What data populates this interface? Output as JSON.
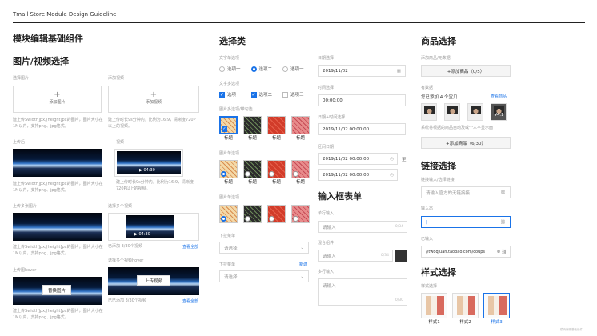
{
  "header": {
    "title": "Tmall Store Module Design Guideline"
  },
  "col1": {
    "main_title": "模块编辑基础组件",
    "section_title": "图片/视频选择",
    "select_image_label": "选择图片",
    "add_image_label": "添加图片",
    "add_video_section_label": "添加视频",
    "add_video_label": "添加视频",
    "image_hint": "建上传Swidth]px,(height]px的图片，图片大小在1M以内，支持png、jpg格式。",
    "video_hint": "建上传时长9s分钟内，比例为16:9，清晰度720P以上的视频。",
    "uploaded_label": "上传后",
    "video_label": "视频",
    "video_time": "04:30",
    "video_hint2": "建上传时长9s分钟内，比例为16:9，清晰度720P以上的视频。",
    "image_hint2": "建上传Swidth]px,(height]px的图片，图片大小在1M以内，支持png、jpg格式。",
    "multi_image_label": "上传多张图片",
    "multi_video_label": "选择多个视频",
    "multi_video_time": "04:30",
    "multi_video_count": "已添加 3/30个视频",
    "view_all": "查看全部",
    "image_hint3": "建上传Swidth]px,(height]px的图片，图片大小在1M以内，支持png、jpg格式。",
    "hover_label": "上传图hover",
    "replace_btn": "替换图片",
    "multi_video_hover_label": "选择多个视频hover",
    "upload_video_btn": "上传视频",
    "multi_video_count2": "已已添加 3/30个视频",
    "view_all2": "查看全部",
    "image_hint4": "建上传Swidth]px,(height]px的图片，图片大小在1M以内，支持png、jpg格式。"
  },
  "col2": {
    "title": "选择类",
    "text_single_label": "文字单选项",
    "radio_options": [
      "选项一",
      "选项二",
      "选项一"
    ],
    "text_multi_label": "文字多选项",
    "check_options": [
      "选项一",
      "选项二",
      "选项三"
    ],
    "img_multi_label": "图片多选项/带勾选",
    "img_single_label": "图片单选项",
    "img_single_label2": "图片单选项",
    "tile_caption": "标题",
    "dropdown_label": "下拉菜单",
    "dropdown_placeholder": "请选择",
    "dropdown2_label": "下拉菜单",
    "dropdown2_new": "新建",
    "dropdown2_placeholder": "请选择"
  },
  "col3": {
    "date_label": "日期选择",
    "date_value": "2019/11/02",
    "time_label": "时间选择",
    "time_value": "00:00:00",
    "datetime_label": "日期+时间选择",
    "datetime_value": "2019/11/02 00:00:00",
    "range_label": "区间日期",
    "range_start": "2019/11/02 00:00:00",
    "range_sep": "至",
    "range_end": "2019/11/02 00:00:00",
    "form_title": "输入框表单",
    "single_input_label": "单行输入",
    "single_input_placeholder": "请输入",
    "single_input_count": "0/34",
    "mixed_label": "混合组件",
    "mixed_placeholder": "请输入",
    "mixed_count": "0/34",
    "multi_input_label": "多行输入",
    "multi_input_placeholder": "请输入",
    "multi_input_count": "0/30"
  },
  "col4": {
    "title": "商品选择",
    "empty_label": "添加商品/无数据",
    "add_btn": "+添加商品（0/5）",
    "has_data_label": "有数据",
    "added_text": "您已添加 4 个宝贝",
    "view_goods": "查看商品",
    "thumb_price": "¥4.1",
    "goods_hint": "系统将根据的商品自动及或个人平显示面",
    "add_btn2": "+添加商品（6/30）",
    "link_title": "链接选择",
    "link_input_label": "链接输入/选择链接",
    "link_placeholder": "请输入官方的无链接接",
    "input_state_label": "输入态",
    "entered_label": "已输入",
    "entered_value": "//twoqiuan.taobao.com/coups",
    "style_title": "样式选择",
    "style_label": "样式选择",
    "styles": [
      "样式1",
      "样式2",
      "样式3"
    ]
  },
  "watermark": "模块编辑基础组件"
}
